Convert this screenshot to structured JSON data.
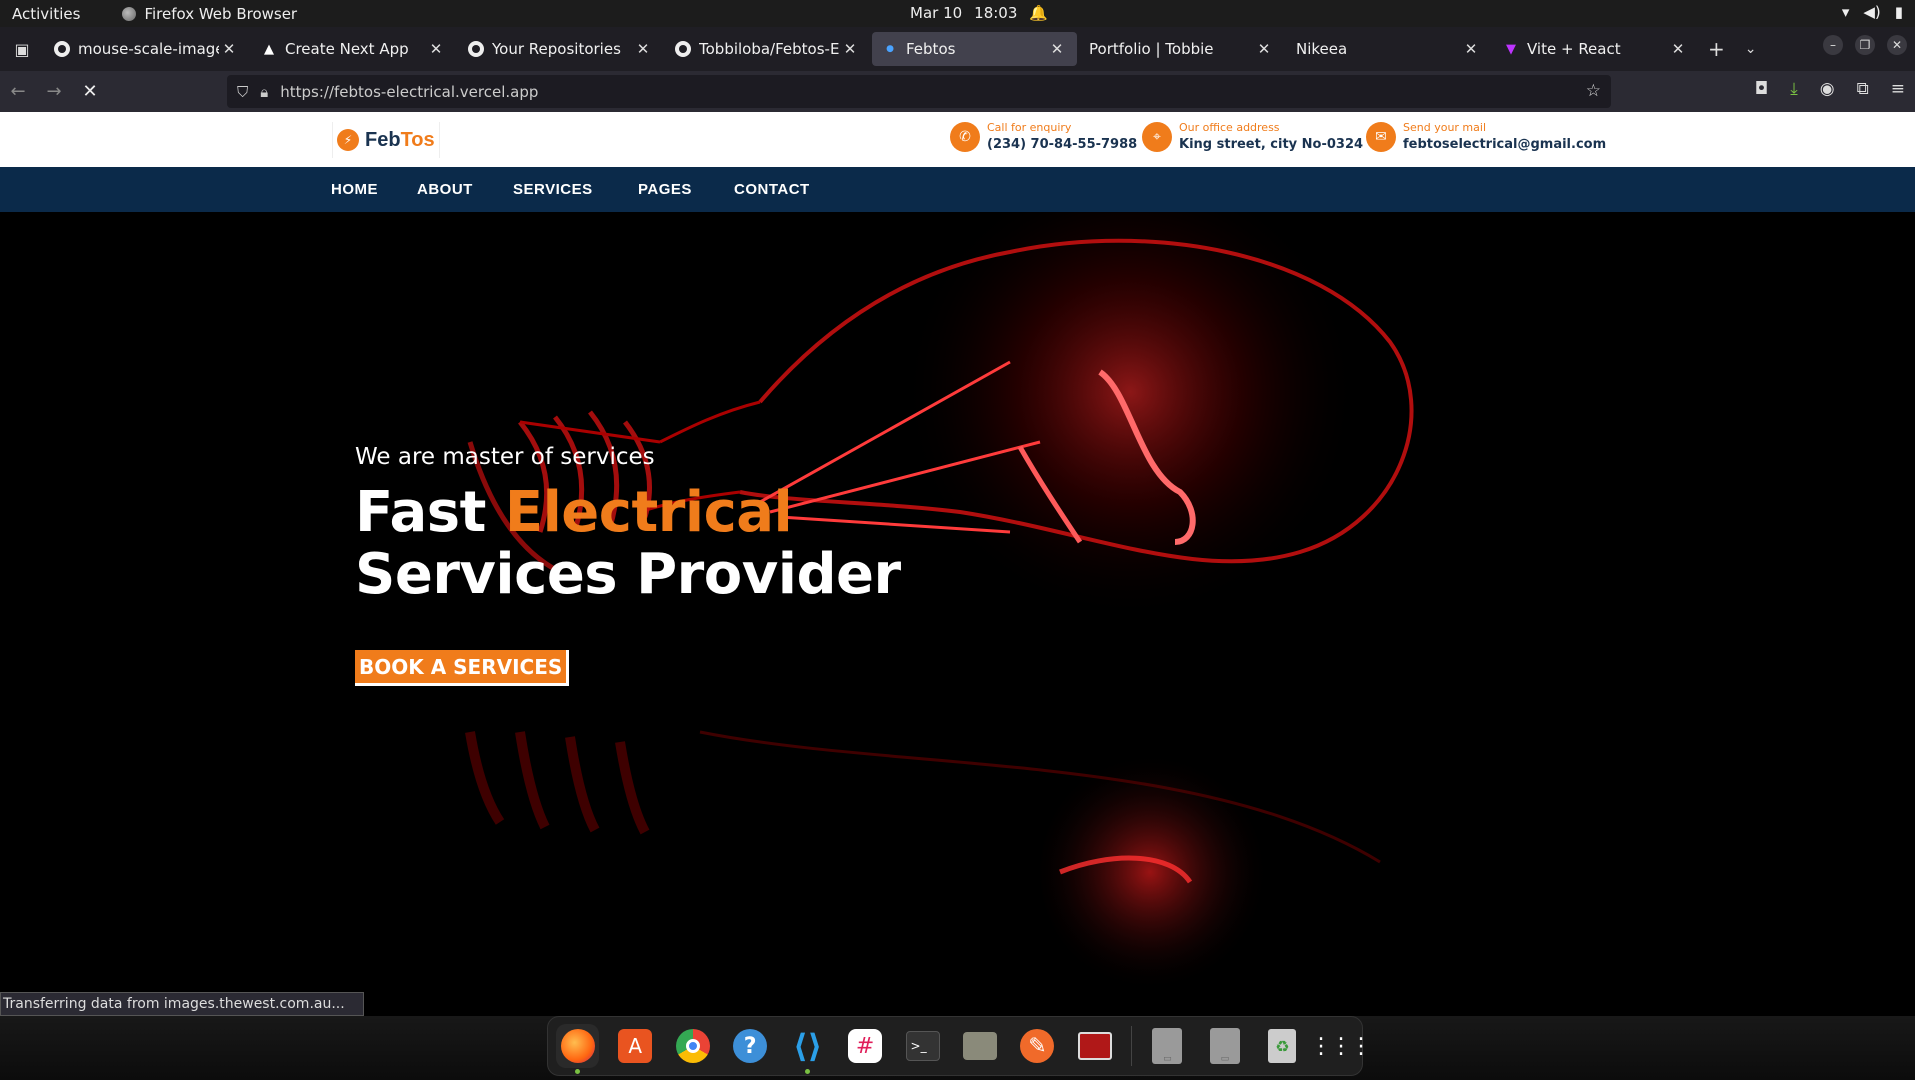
{
  "system": {
    "activities": "Activities",
    "app_name": "Firefox Web Browser",
    "date": "Mar 10",
    "time": "18:03"
  },
  "tabs": [
    {
      "title": "mouse-scale-image-ga",
      "icon": "github-icon",
      "active": false
    },
    {
      "title": "Create Next App",
      "icon": "triangle-icon",
      "active": false
    },
    {
      "title": "Your Repositories",
      "icon": "github-icon",
      "active": false
    },
    {
      "title": "Tobbiloba/Febtos-Elec",
      "icon": "github-icon",
      "active": false
    },
    {
      "title": "Febtos",
      "icon": "loading-icon",
      "active": true
    },
    {
      "title": "Portfolio | Tobbie",
      "icon": "none",
      "active": false
    },
    {
      "title": "Nikeea",
      "icon": "none",
      "active": false
    },
    {
      "title": "Vite + React",
      "icon": "vite-icon",
      "active": false
    }
  ],
  "browser": {
    "url": "https://febtos-electrical.vercel.app",
    "status": "Transferring data from images.thewest.com.au..."
  },
  "site": {
    "logo": {
      "part1": "Feb",
      "part2": "Tos"
    },
    "contacts": [
      {
        "label": "Call for enquiry",
        "value": "(234) 70-84-55-7988",
        "icon": "phone-icon"
      },
      {
        "label": "Our office address",
        "value": "King street, city No-0324",
        "icon": "location-pin-icon"
      },
      {
        "label": "Send your mail",
        "value": "febtoselectrical@gmail.com",
        "icon": "mail-icon"
      }
    ],
    "nav": [
      "HOME",
      "ABOUT",
      "SERVICES",
      "PAGES",
      "CONTACT"
    ],
    "hero": {
      "tagline": "We are master of services",
      "title_part1": "Fast ",
      "title_accent": "Electrical",
      "title_line2": "Services Provider",
      "cta": "BOOK A SERVICES"
    },
    "accent_color": "#f07c1b",
    "nav_color": "#0b2a4a"
  },
  "dock": [
    "firefox-icon",
    "app-center-icon",
    "chrome-icon",
    "help-icon",
    "vscode-icon",
    "slack-icon",
    "terminal-icon",
    "files-icon",
    "inkscape-icon",
    "screenshot-icon",
    "ssd-icon",
    "ssd-icon",
    "trash-icon",
    "app-grid-icon"
  ]
}
